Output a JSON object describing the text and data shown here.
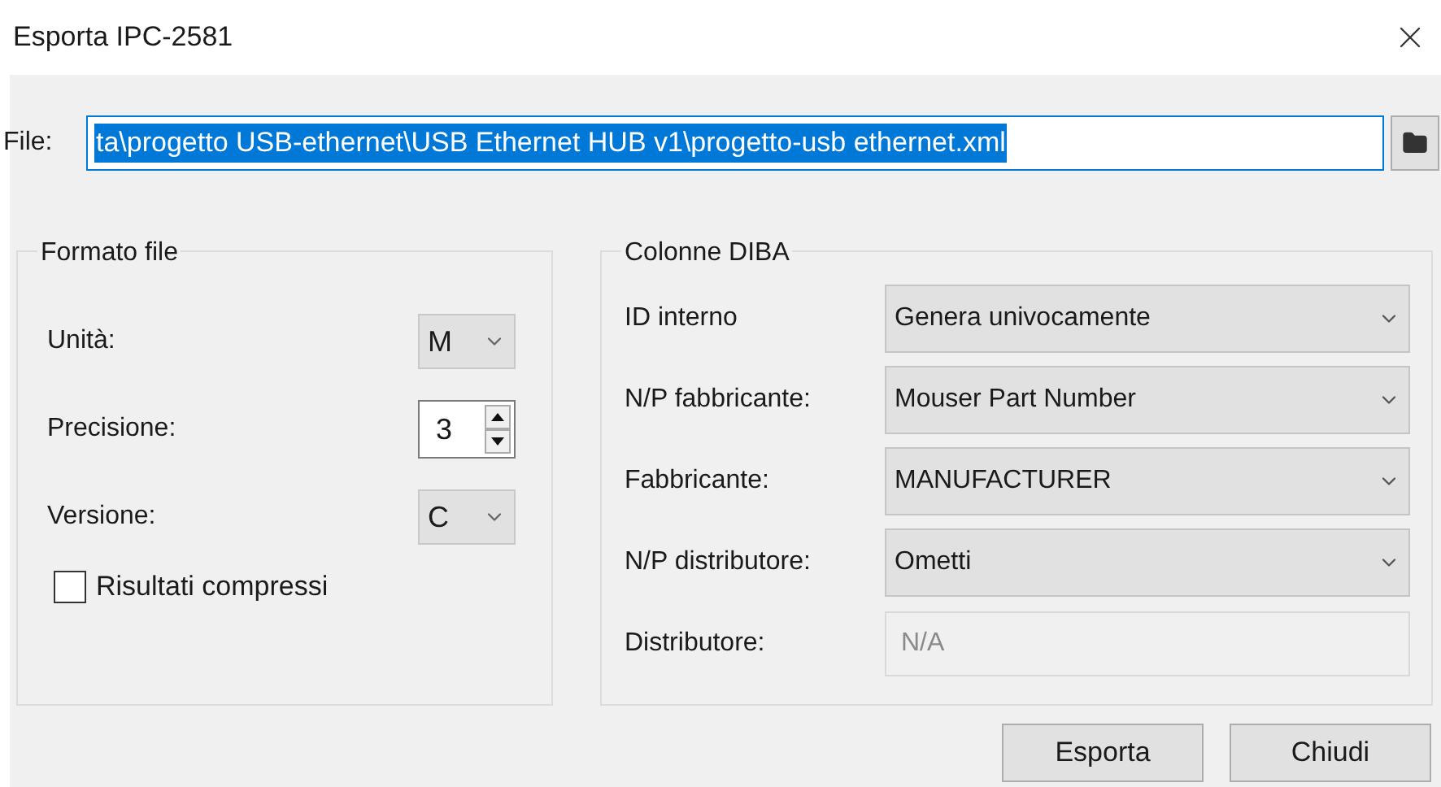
{
  "window": {
    "title": "Esporta IPC-2581"
  },
  "file": {
    "label": "File:",
    "value": "ta\\progetto USB-ethernet\\USB Ethernet HUB v1\\progetto-usb ethernet.xml"
  },
  "format_group": {
    "title": "Formato file",
    "rows": [
      {
        "kind": "combo",
        "label": "Unità:",
        "value": "M"
      },
      {
        "kind": "spinner",
        "label": "Precisione:",
        "value": "3"
      },
      {
        "kind": "combo",
        "label": "Versione:",
        "value": "C"
      }
    ],
    "checkbox": {
      "label": "Risultati compressi",
      "checked": false
    }
  },
  "bom_group": {
    "title": "Colonne DIBA",
    "rows": [
      {
        "label": "ID interno",
        "value": "Genera univocamente",
        "disabled": false
      },
      {
        "label": "N/P fabbricante:",
        "value": "Mouser Part Number",
        "disabled": false
      },
      {
        "label": "Fabbricante:",
        "value": "MANUFACTURER",
        "disabled": false
      },
      {
        "label": "N/P distributore:",
        "value": "Ometti",
        "disabled": false
      },
      {
        "label": "Distributore:",
        "value": "N/A",
        "disabled": true
      }
    ]
  },
  "buttons": [
    "Esporta",
    "Chiudi"
  ]
}
